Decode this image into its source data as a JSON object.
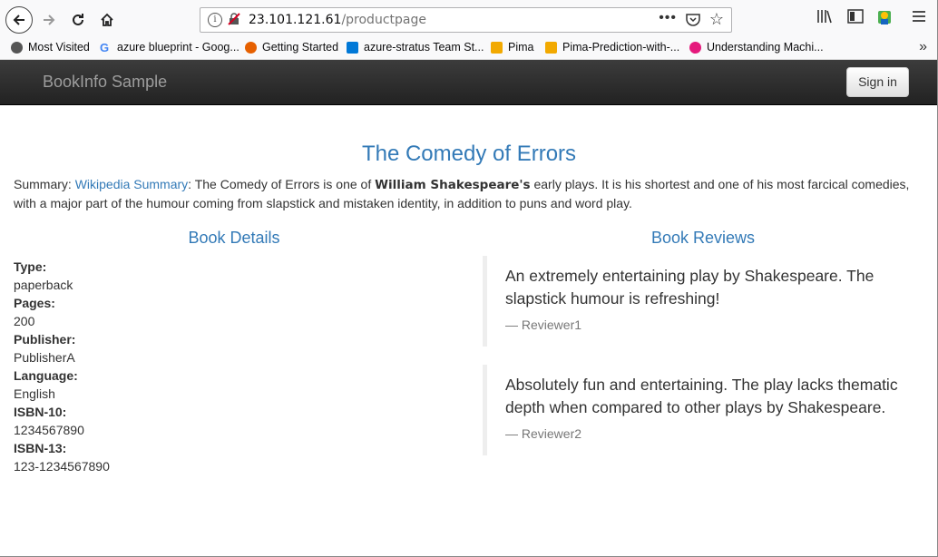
{
  "browser": {
    "url_host": "23.101.121.61",
    "url_path": "/productpage",
    "url_dots": "•••",
    "bookmarks": [
      {
        "label": "Most Visited",
        "icon": "gear-icon",
        "color": "#555555"
      },
      {
        "label": "azure blueprint - Goog...",
        "icon": "google-icon",
        "color": "#4285f4"
      },
      {
        "label": "Getting Started",
        "icon": "firefox-icon",
        "color": "#e66000"
      },
      {
        "label": "azure-stratus Team St...",
        "icon": "azure-devops-icon",
        "color": "#0078d7"
      },
      {
        "label": "Pima",
        "icon": "notebook-icon",
        "color": "#f2a900"
      },
      {
        "label": "Pima-Prediction-with-...",
        "icon": "notebook-icon",
        "color": "#f2a900"
      },
      {
        "label": "Understanding Machi...",
        "icon": "video-icon",
        "color": "#e5197c"
      }
    ],
    "more_bookmarks": "»"
  },
  "app": {
    "brand": "BookInfo Sample",
    "signin_label": "Sign in"
  },
  "book": {
    "title": "The Comedy of Errors",
    "summary_label": "Summary: ",
    "summary_link": "Wikipedia Summary",
    "summary_part1": ": The Comedy of Errors is one of ",
    "summary_bold": "William Shakespeare's",
    "summary_part2": " early plays. It is his shortest and one of his most farcical comedies, with a major part of the humour coming from slapstick and mistaken identity, in addition to puns and word play."
  },
  "details": {
    "heading": "Book Details",
    "type_label": "Type:",
    "type_value": "paperback",
    "pages_label": "Pages:",
    "pages_value": "200",
    "publisher_label": "Publisher:",
    "publisher_value": "PublisherA",
    "language_label": "Language:",
    "language_value": "English",
    "isbn10_label": "ISBN-10:",
    "isbn10_value": "1234567890",
    "isbn13_label": "ISBN-13:",
    "isbn13_value": "123-1234567890"
  },
  "reviews": {
    "heading": "Book Reviews",
    "items": [
      {
        "text": "An extremely entertaining play by Shakespeare. The slapstick humour is refreshing!",
        "reviewer": "— Reviewer1"
      },
      {
        "text": "Absolutely fun and entertaining. The play lacks thematic depth when compared to other plays by Shakespeare.",
        "reviewer": "— Reviewer2"
      }
    ]
  }
}
